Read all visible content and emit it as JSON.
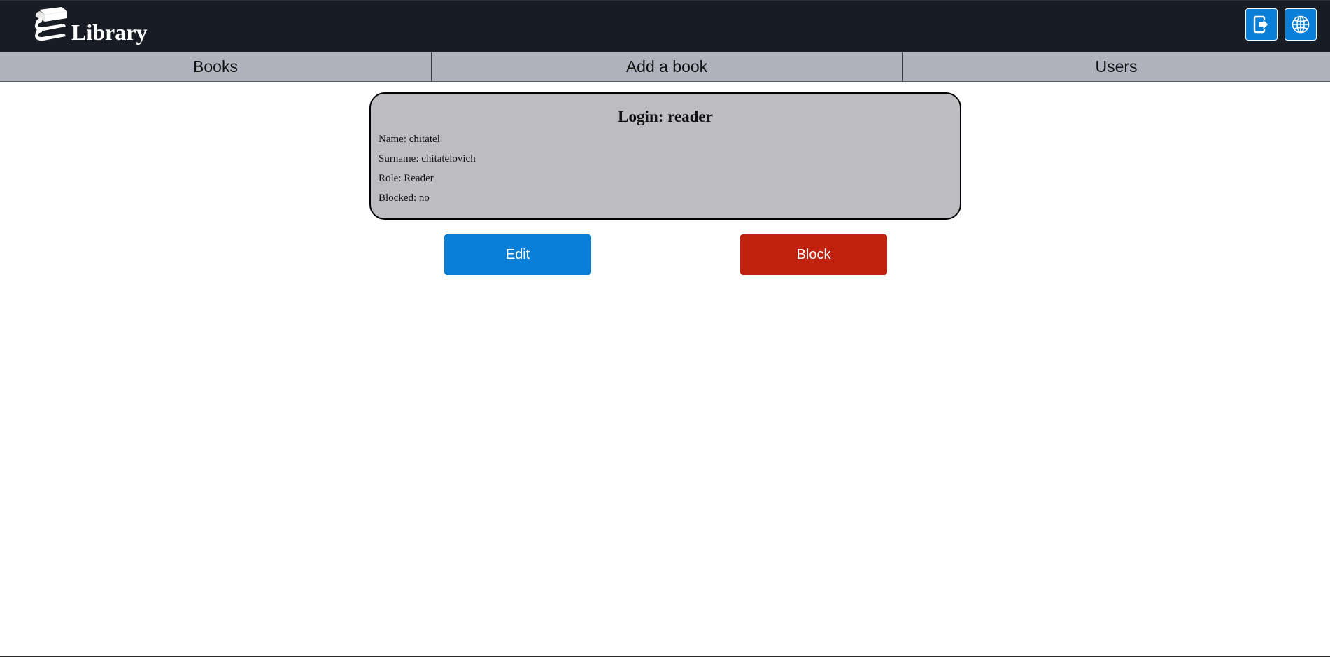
{
  "app": {
    "title": "Library",
    "logo_icon": "books-stack-icon"
  },
  "header": {
    "buttons": [
      {
        "name": "logout",
        "icon": "logout-icon"
      },
      {
        "name": "language",
        "icon": "globe-icon"
      }
    ],
    "bg_color": "#181c24",
    "button_color": "#0a7fd8"
  },
  "nav": {
    "items": [
      {
        "label": "Books"
      },
      {
        "label": "Add a book"
      },
      {
        "label": "Users"
      }
    ],
    "bg_color": "#b0b3bd"
  },
  "user_card": {
    "title": "Login: reader",
    "fields": [
      "Name: chitatel",
      "Surname: chitatelovich",
      "Role: Reader",
      "Blocked: no"
    ],
    "bg_color": "#bdbcc1"
  },
  "actions": {
    "edit_label": "Edit",
    "block_label": "Block",
    "edit_color": "#0a7fd8",
    "block_color": "#c1210f"
  }
}
